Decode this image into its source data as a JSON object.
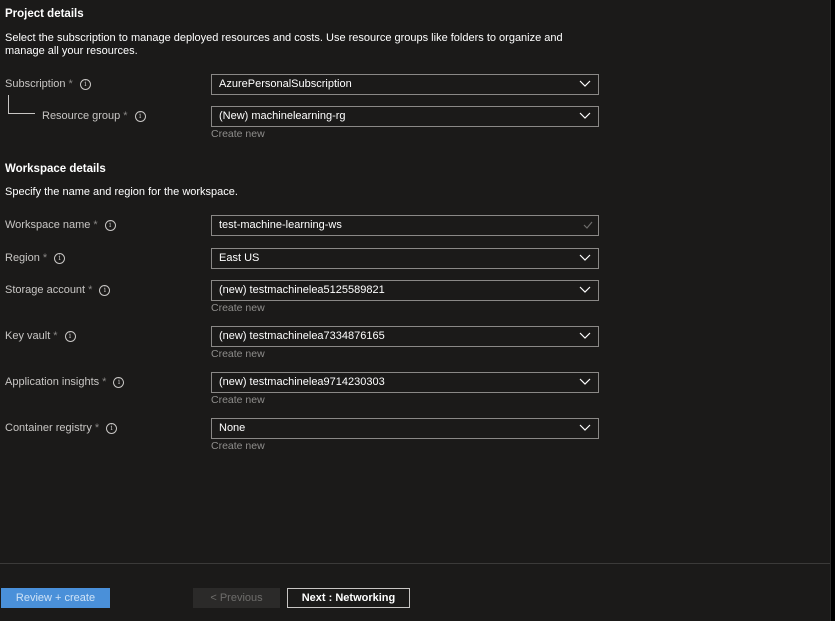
{
  "project": {
    "title": "Project details",
    "description": "Select the subscription to manage deployed resources and costs. Use resource groups like folders to organize and manage all your resources.",
    "subscription": {
      "label": "Subscription",
      "required_mark": "*",
      "value": "AzurePersonalSubscription"
    },
    "resource_group": {
      "label": "Resource group",
      "required_mark": "*",
      "value": "(New) machinelearning-rg",
      "create_link": "Create new"
    }
  },
  "workspace": {
    "title": "Workspace details",
    "description": "Specify the name and region for the workspace.",
    "name": {
      "label": "Workspace name",
      "required_mark": "*",
      "value": "test-machine-learning-ws"
    },
    "region": {
      "label": "Region",
      "required_mark": "*",
      "value": "East US"
    },
    "storage": {
      "label": "Storage account",
      "required_mark": "*",
      "value": "(new) testmachinelea5125589821",
      "create_link": "Create new"
    },
    "keyvault": {
      "label": "Key vault",
      "required_mark": "*",
      "value": "(new) testmachinelea7334876165",
      "create_link": "Create new"
    },
    "insights": {
      "label": "Application insights",
      "required_mark": "*",
      "value": "(new) testmachinelea9714230303",
      "create_link": "Create new"
    },
    "registry": {
      "label": "Container registry",
      "required_mark": "*",
      "value": "None",
      "create_link": "Create new"
    }
  },
  "footer": {
    "review_create": "Review + create",
    "previous": "< Previous",
    "next": "Next : Networking"
  },
  "icons": {
    "info": "info-icon",
    "chevron": "chevron-down-icon",
    "check": "checkmark-icon"
  },
  "colors": {
    "background": "#1b1a19",
    "primary_button": "#4a90d9",
    "field_border": "#8a8886",
    "link": "#8f8e8c"
  }
}
